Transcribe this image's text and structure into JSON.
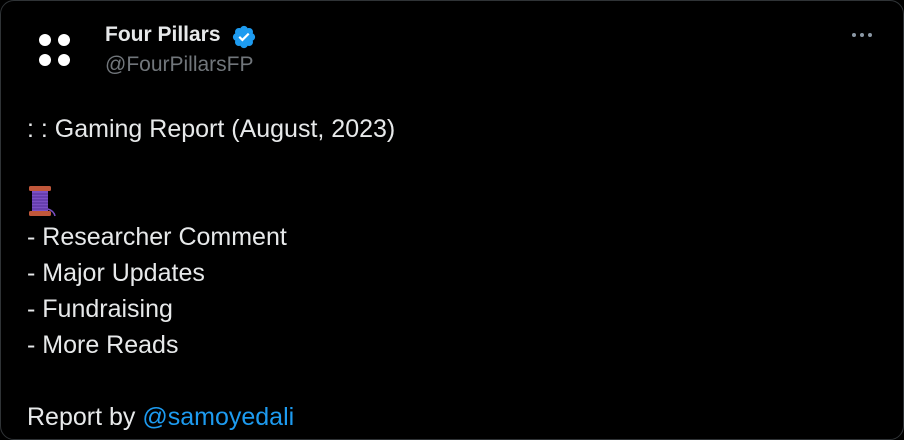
{
  "author": {
    "name": "Four Pillars",
    "handle": "@FourPillarsFP",
    "verified": true,
    "verified_color": "#1d9bf0",
    "avatar_icon": "four-dots-logo"
  },
  "tweet": {
    "title_line": ": : Gaming Report (August, 2023)",
    "emoji_icon": "thread-spool-icon",
    "items": [
      "- Researcher Comment",
      "- Major Updates",
      "- Fundraising",
      "- More Reads"
    ],
    "credit_prefix": "Report by ",
    "mention": "@samoyedali"
  },
  "colors": {
    "background": "#000000",
    "text": "#e7e9ea",
    "secondary_text": "#71767b",
    "link": "#1d9bf0"
  }
}
